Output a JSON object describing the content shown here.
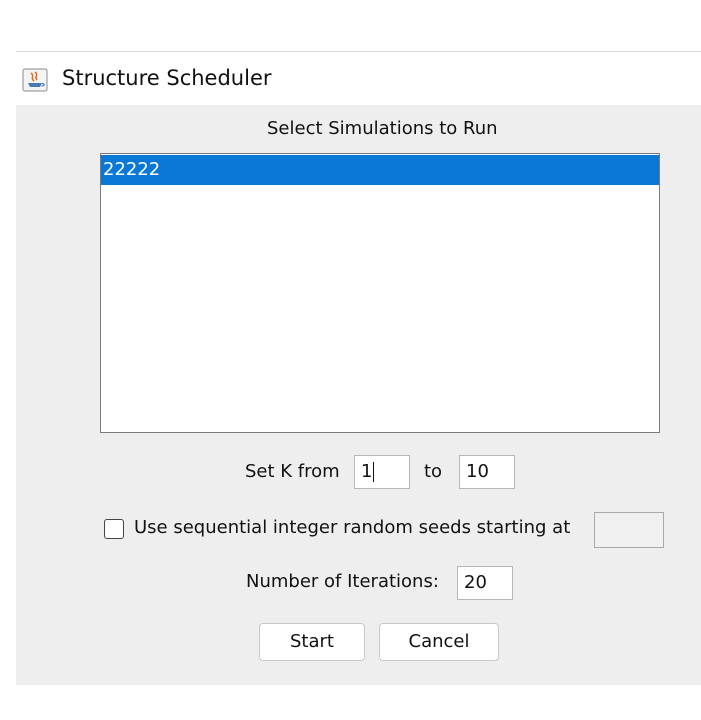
{
  "window": {
    "title": "Structure Scheduler",
    "icon": "java-app-icon"
  },
  "dialog": {
    "list_heading": "Select Simulations to Run",
    "simulations": [
      {
        "label": "22222",
        "selected": true
      }
    ],
    "k_range": {
      "from_label": "Set K from",
      "from_value": "1",
      "to_label": "to",
      "to_value": "10"
    },
    "seed_option": {
      "checked": false,
      "label": "Use sequential integer random seeds starting at",
      "value": ""
    },
    "iterations": {
      "label": "Number of Iterations:",
      "value": "20"
    },
    "buttons": {
      "start": "Start",
      "cancel": "Cancel"
    }
  },
  "colors": {
    "selection": "#0a78d7",
    "dialog_background": "#eeeeee"
  }
}
